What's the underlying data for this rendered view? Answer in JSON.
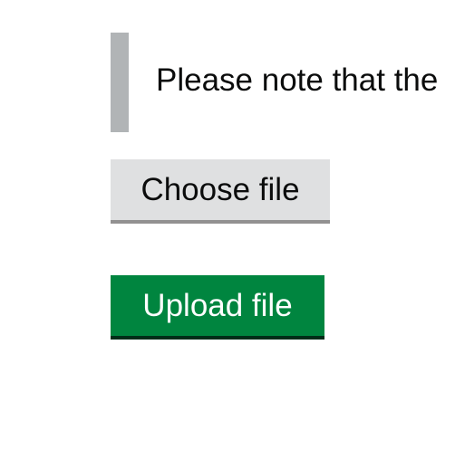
{
  "inset_text": {
    "text": "Please note that the"
  },
  "buttons": {
    "choose_file_label": "Choose file",
    "upload_file_label": "Upload file"
  },
  "colors": {
    "inset_border": "#b1b4b6",
    "secondary_button_bg": "#dfe0e1",
    "primary_button_bg": "#00853f",
    "primary_button_text": "#ffffff",
    "body_text": "#0b0c0c"
  }
}
